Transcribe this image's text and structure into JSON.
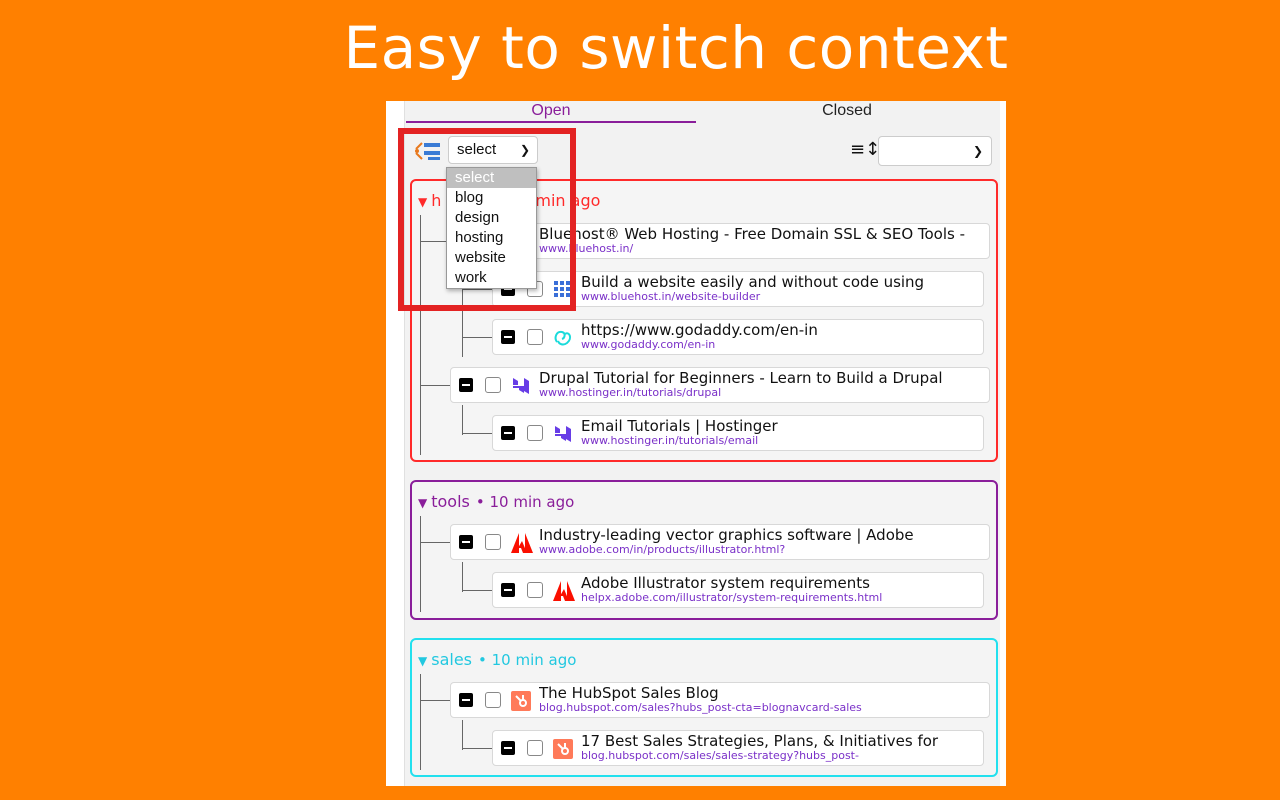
{
  "headline": "Easy to switch context",
  "tabs": {
    "open": "Open",
    "closed": "Closed"
  },
  "toolbar": {
    "context_select_value": "select",
    "sort_select_value": ""
  },
  "dropdown": {
    "options": [
      "select",
      "blog",
      "design",
      "hosting",
      "website",
      "work"
    ],
    "selected_index": 0
  },
  "groups": [
    {
      "header_visible": "h",
      "time_visible": "min ago",
      "color": "#ff2a2a",
      "tabs": [
        {
          "title": "Bluehost® Web Hosting - Free Domain SSL & SEO Tools -",
          "url": "www.bluehost.in/",
          "icon": "bluehost-icon"
        },
        {
          "title": "Build a website easily and without code using",
          "url": "www.bluehost.in/website-builder",
          "icon": "bluehost-grid-icon"
        },
        {
          "title": "https://www.godaddy.com/en-in",
          "url": "www.godaddy.com/en-in",
          "icon": "godaddy-icon"
        },
        {
          "title": "Drupal Tutorial for Beginners - Learn to Build a Drupal",
          "url": "www.hostinger.in/tutorials/drupal",
          "icon": "hostinger-icon"
        },
        {
          "title": "Email Tutorials | Hostinger",
          "url": "www.hostinger.in/tutorials/email",
          "icon": "hostinger-icon"
        }
      ]
    },
    {
      "name": "tools",
      "time": "• 10 min ago",
      "color": "#8a1e9a",
      "tabs": [
        {
          "title": "Industry-leading vector graphics software | Adobe",
          "url": "www.adobe.com/in/products/illustrator.html?",
          "icon": "adobe-icon"
        },
        {
          "title": "Adobe Illustrator system requirements",
          "url": "helpx.adobe.com/illustrator/system-requirements.html",
          "icon": "adobe-icon"
        }
      ]
    },
    {
      "name": "sales",
      "time": "• 10 min ago",
      "color": "#22c8e0",
      "tabs": [
        {
          "title": "The HubSpot Sales Blog",
          "url": "blog.hubspot.com/sales?hubs_post-cta=blognavcard-sales",
          "icon": "hubspot-icon"
        },
        {
          "title": "17 Best Sales Strategies, Plans, & Initiatives for",
          "url": "blog.hubspot.com/sales/sales-strategy?hubs_post-",
          "icon": "hubspot-icon"
        }
      ]
    }
  ]
}
